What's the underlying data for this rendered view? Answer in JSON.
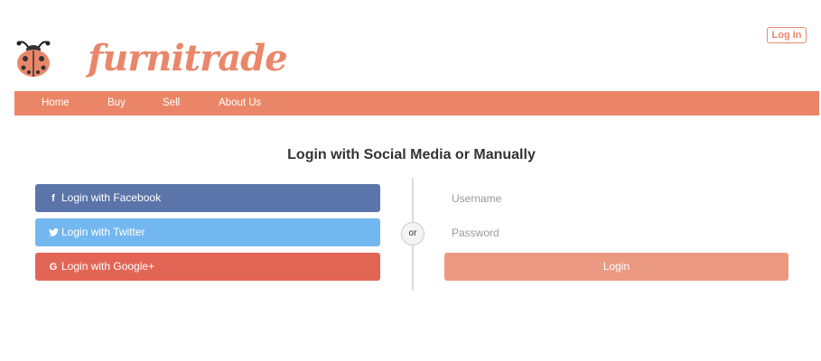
{
  "brand": {
    "name": "furnitrade",
    "color": "#e9876a",
    "logo_icon": "ladybug-icon"
  },
  "header": {
    "login_link": "Log In"
  },
  "nav": {
    "items": [
      "Home",
      "Buy",
      "Sell",
      "About Us"
    ],
    "background": "#ea8667"
  },
  "main": {
    "title": "Login with Social Media or Manually"
  },
  "social": {
    "facebook": {
      "label": "Login with Facebook",
      "icon": "facebook-icon",
      "color": "#5b75aa"
    },
    "twitter": {
      "label": "Login with Twitter",
      "icon": "twitter-icon",
      "color": "#73b7f0"
    },
    "google": {
      "label": "Login with Google+",
      "icon": "google-icon",
      "color": "#e36556"
    }
  },
  "separator": {
    "label": "or"
  },
  "form": {
    "username_placeholder": "Username",
    "password_placeholder": "Password",
    "login_label": "Login",
    "login_color": "#ec9982"
  }
}
